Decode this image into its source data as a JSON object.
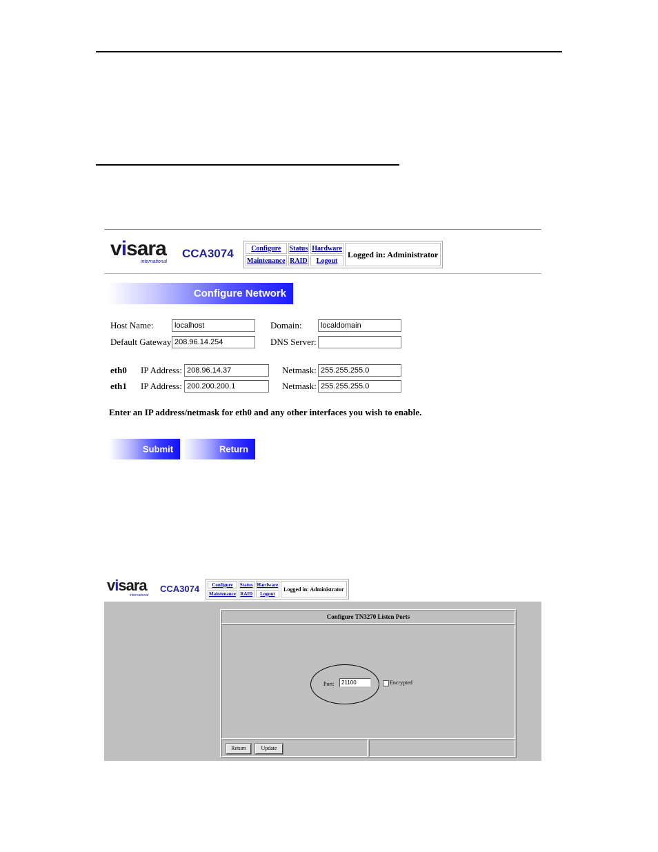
{
  "screen1": {
    "brand": {
      "logo_word_prefix": "v",
      "logo_word_i": "i",
      "logo_word_suffix": "sara",
      "logo_sub": "international",
      "model": "CCA3074"
    },
    "nav": {
      "configure": "Configure",
      "status": "Status",
      "hardware": "Hardware",
      "maintenance": "Maintenance",
      "raid": "RAID",
      "logout": "Logout",
      "logged_in": "Logged in: Administrator"
    },
    "banner_title": "Configure Network",
    "form": {
      "host_name_label": "Host Name:",
      "host_name_value": "localhost",
      "domain_label": "Domain:",
      "domain_value": "localdomain",
      "gateway_label": "Default Gateway:",
      "gateway_value": "208.96.14.254",
      "dns_label": "DNS Server:",
      "dns_value": "",
      "eth0_label": "eth0",
      "eth0_ip_label": "IP Address:",
      "eth0_ip_value": "208.96.14.37",
      "eth0_netmask_label": "Netmask:",
      "eth0_netmask_value": "255.255.255.0",
      "eth1_label": "eth1",
      "eth1_ip_label": "IP Address:",
      "eth1_ip_value": "200.200.200.1",
      "eth1_netmask_label": "Netmask:",
      "eth1_netmask_value": "255.255.255.0"
    },
    "instructions": "Enter an IP address/netmask for eth0 and any other interfaces you wish to enable.",
    "buttons": {
      "submit": "Submit",
      "return": "Return"
    }
  },
  "screen2": {
    "brand": {
      "logo_word_prefix": "v",
      "logo_word_i": "i",
      "logo_word_suffix": "sara",
      "logo_sub": "international",
      "model": "CCA3074"
    },
    "nav": {
      "configure": "Configure",
      "status": "Status",
      "hardware": "Hardware",
      "maintenance": "Maintenance",
      "raid": "RAID",
      "logout": "Logout",
      "logged_in": "Logged in: Administrator"
    },
    "panel_title": "Configure TN3270 Listen Ports",
    "port_label": "Port:",
    "port_value": "21100",
    "encrypted_label": "Encrypted",
    "encrypted_checked": false,
    "buttons": {
      "return": "Return",
      "update": "Update"
    }
  }
}
